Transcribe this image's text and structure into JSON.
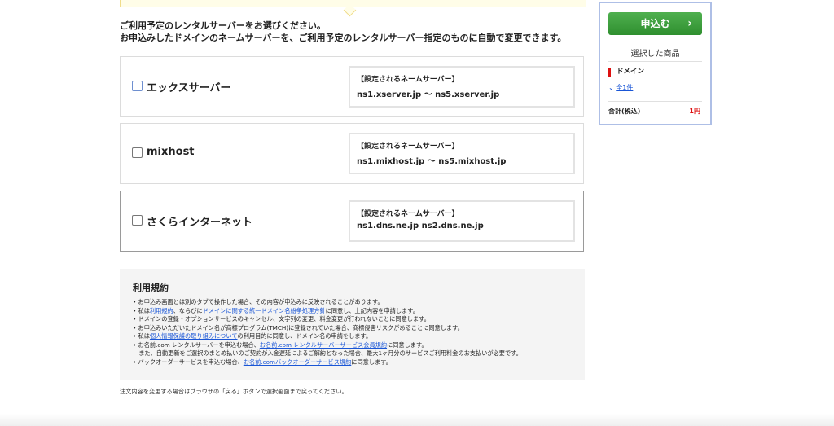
{
  "intro": {
    "line1": "ご利用予定のレンタルサーバーをお選びください。",
    "line2": "お申込みしたドメインのネームサーバーを、ご利用予定のレンタルサーバー指定のものに自動で変更できます。"
  },
  "options": [
    {
      "label": "エックスサーバー",
      "ns_title": "【設定されるネームサーバー】",
      "ns_value": "ns1.xserver.jp 〜 ns5.xserver.jp"
    },
    {
      "label": "mixhost",
      "ns_title": "【設定されるネームサーバー】",
      "ns_value": "ns1.mixhost.jp 〜 ns5.mixhost.jp"
    },
    {
      "label": "さくらインターネット",
      "ns_title": "【設定されるネームサーバー】",
      "ns_value": "ns1.dns.ne.jp ns2.dns.ne.jp"
    }
  ],
  "terms": {
    "heading": "利用規約",
    "l1": "お申込み画面とは別のタブで操作した場合、その内容が申込みに反映されることがあります。",
    "l2a": "私は",
    "l2_link1": "利用規約",
    "l2b": "、ならびに",
    "l2_link2": "ドメインに関する統一ドメイン名紛争処理方針",
    "l2c": "に同意し、上記内容を申請します。",
    "l3": "ドメインの登録・オプションサービスのキャンセル、文字列の変更、料金変更が行われないことに同意します。",
    "l4": "お申込みいただいたドメイン名が商標プログラム(TMCH)に登録されていた場合、商標侵害リスクがあることに同意します。",
    "l5a": "私は",
    "l5_link": "個人情報保護の取り組みについて",
    "l5b": "の利用目的に同意し、ドメイン名の申請をします。",
    "l6a": "お名前.com レンタルサーバーを申込む場合、",
    "l6_link": "お名前.com レンタルサーバーサービス会員規約",
    "l6b": "に同意します。",
    "l7": "また、自動更新をご選択のまとめ払いのご契約が入金遅延によるご解約となった場合、最大1ヶ月分のサービスご利用料金のお支払いが必要です。",
    "l8a": "バックオーダーサービスを申込む場合、",
    "l8_link": "お名前.comバックオーダーサービス規約",
    "l8b": "に同意します。"
  },
  "footer_note": "注文内容を変更する場合はブラウザの「戻る」ボタンで選択画面まで戻ってください。",
  "sidebar": {
    "apply_label": "申込む",
    "apply_icon": "chevron-right",
    "selected_title": "選択した商品",
    "domain_label": "ドメイン",
    "count_label": "全1件",
    "total_label": "合計(税込)",
    "total_value": "1円"
  },
  "colors": {
    "accent_green": "#3a9c3a",
    "price_red": "#dd1111",
    "link_blue": "#1a56d6"
  }
}
